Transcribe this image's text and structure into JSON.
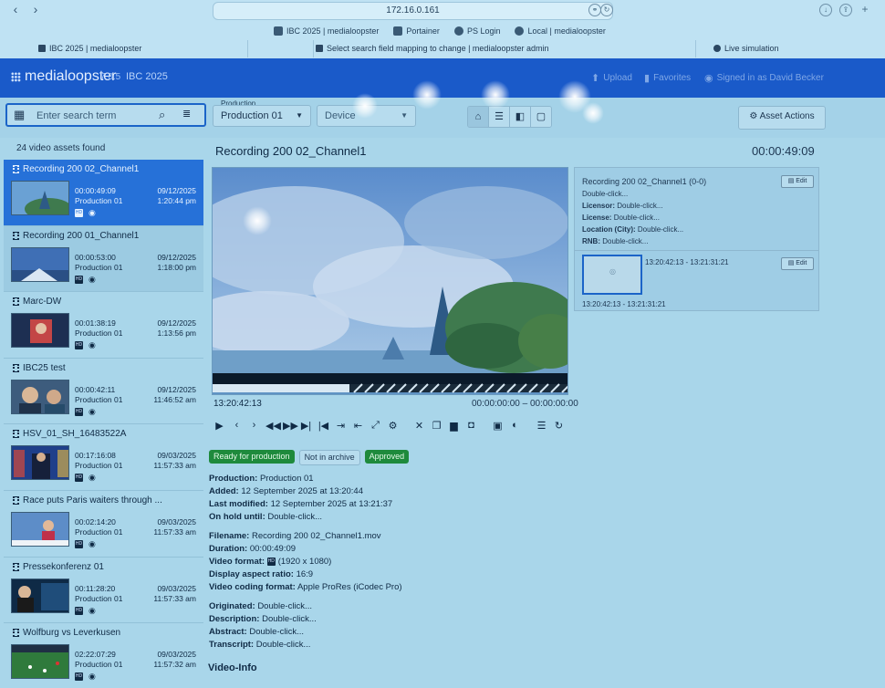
{
  "browser": {
    "url": "172.16.0.161",
    "bookmarks": [
      "IBC 2025 | medialoopster",
      "Portainer",
      "PS Login",
      "Local | medialoopster"
    ],
    "tabs": [
      "IBC 2025 | medialoopster",
      "Select search field mapping to change | medialoopster admin",
      "Live simulation"
    ]
  },
  "app": {
    "logo": "medialoopster",
    "version": "7.0.5",
    "event": "IBC 2025",
    "header_links": [
      "Upload",
      "Favorites",
      "Signed in as David Becker"
    ]
  },
  "toolbar": {
    "search_placeholder": "Enter search term",
    "production_label": "Production",
    "production_value": "Production 01",
    "device_placeholder": "Device",
    "asset_actions": "Asset Actions"
  },
  "list": {
    "count_text": "24 video assets found",
    "assets": [
      {
        "title": "Recording 200 02_Channel1",
        "duration": "00:00:49:09",
        "production": "Production 01",
        "date": "09/12/2025",
        "time": "1:20:44 pm"
      },
      {
        "title": "Recording 200 01_Channel1",
        "duration": "00:00:53:00",
        "production": "Production 01",
        "date": "09/12/2025",
        "time": "1:18:00 pm"
      },
      {
        "title": "Marc-DW",
        "duration": "00:01:38:19",
        "production": "Production 01",
        "date": "09/12/2025",
        "time": "1:13:56 pm"
      },
      {
        "title": "IBC25 test",
        "duration": "00:00:42:11",
        "production": "Production 01",
        "date": "09/12/2025",
        "time": "11:46:52 am"
      },
      {
        "title": "HSV_01_SH_16483522A",
        "duration": "00:17:16:08",
        "production": "Production 01",
        "date": "09/03/2025",
        "time": "11:57:33 am"
      },
      {
        "title": "Race puts Paris waiters through ...",
        "duration": "00:02:14:20",
        "production": "Production 01",
        "date": "09/03/2025",
        "time": "11:57:33 am"
      },
      {
        "title": "Pressekonferenz 01",
        "duration": "00:11:28:20",
        "production": "Production 01",
        "date": "09/03/2025",
        "time": "11:57:33 am"
      },
      {
        "title": "Wolfburg vs Leverkusen",
        "duration": "02:22:07:29",
        "production": "Production 01",
        "date": "09/03/2025",
        "time": "11:57:32 am"
      }
    ]
  },
  "main": {
    "title": "Recording 200 02_Channel1",
    "duration": "00:00:49:09",
    "timecode": "13:20:42:13",
    "range": "00:00:00:00 – 00:00:00:00",
    "badges": [
      "Ready for production",
      "Not in archive",
      "Approved"
    ],
    "meta_group1": [
      {
        "label": "Production:",
        "value": "Production 01"
      },
      {
        "label": "Added:",
        "value": "12 September 2025 at 13:20:44"
      },
      {
        "label": "Last modified:",
        "value": "12 September 2025 at 13:21:37"
      },
      {
        "label": "On hold until:",
        "value": "Double-click..."
      }
    ],
    "meta_group2": [
      {
        "label": "Filename:",
        "value": "Recording 200 02_Channel1.mov"
      },
      {
        "label": "Duration:",
        "value": "00:00:49:09"
      },
      {
        "label": "Video format:",
        "value": "(1920 x 1080)"
      },
      {
        "label": "Display aspect ratio:",
        "value": "16:9"
      },
      {
        "label": "Video coding format:",
        "value": "Apple ProRes (iCodec Pro)"
      }
    ],
    "meta_group3": [
      {
        "label": "Originated:",
        "value": "Double-click..."
      },
      {
        "label": "Description:",
        "value": "Double-click..."
      },
      {
        "label": "Abstract:",
        "value": "Double-click..."
      },
      {
        "label": "Transcript:",
        "value": "Double-click..."
      }
    ],
    "video_info": "Video-Info"
  },
  "panel": {
    "header": "Recording 200 02_Channel1 (0-0)",
    "edit": "Edit",
    "lines": [
      {
        "label": "",
        "value": "Double-click..."
      },
      {
        "label": "Licensor:",
        "value": "Double-click..."
      },
      {
        "label": "License:",
        "value": "Double-click..."
      },
      {
        "label": "Location (City):",
        "value": "Double-click..."
      },
      {
        "label": "RNB:",
        "value": "Double-click..."
      }
    ],
    "segment_range": "13:20:42:13 - 13:21:31:21",
    "segment_range_bottom": "13:20:42:13 - 13:21:31:21"
  },
  "colors": {
    "brand": "#1a5ac9",
    "selected": "#2671d8",
    "approved": "#1e8a3c"
  }
}
